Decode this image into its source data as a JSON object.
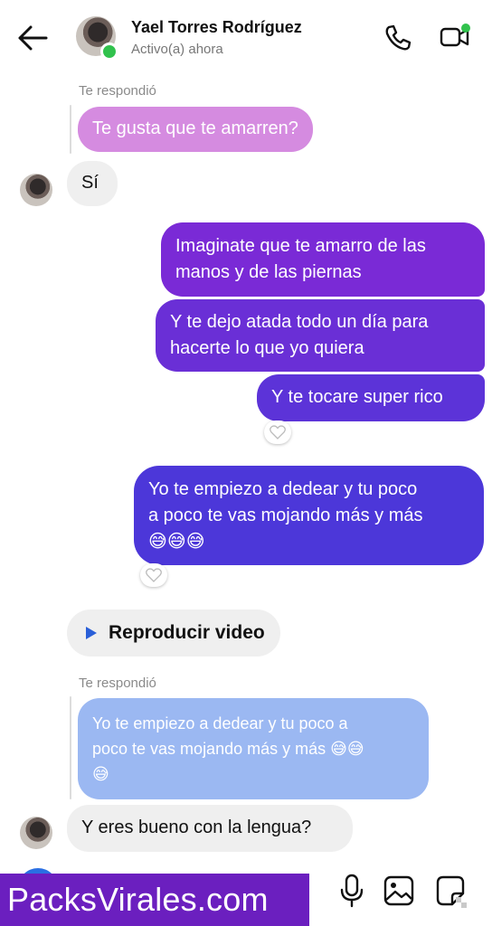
{
  "header": {
    "contact_name": "Yael Torres Rodríguez",
    "status": "Activo(a) ahora"
  },
  "thread": {
    "reply_label_1": "Te respondió",
    "quoted_1": "Te gusta que te amarren?",
    "incoming_1": "Sí",
    "outgoing_1": [
      "Imaginate que te amarro de las",
      "manos y de las piernas"
    ],
    "outgoing_2": [
      "Y te dejo atada todo un día para",
      "hacerte lo que yo quiera"
    ],
    "outgoing_3": "Y te tocare super rico",
    "outgoing_4": [
      "Yo te empiezo a dedear y tu poco",
      "a poco te vas mojando más y más",
      "😅😅😅"
    ],
    "video_label": "Reproducir video",
    "reply_label_2": "Te respondió",
    "quoted_2": [
      "Yo te empiezo a dedear y tu poco a",
      "poco te vas mojando más y más 😅😅",
      "😅"
    ],
    "incoming_2": "Y eres bueno con la lengua?"
  },
  "watermark": "PacksVirales.com",
  "colors": {
    "outgoing_top": "#7a2ad6",
    "outgoing_bottom": "#4c37d9",
    "quoted_pink": "#d58be0",
    "quoted_blue": "#9bb8f2",
    "online": "#31c24d",
    "watermark_bg": "#6b1fbf"
  },
  "icons": [
    "back-arrow-icon",
    "phone-icon",
    "video-call-icon",
    "heart-reaction-icon",
    "play-icon",
    "camera-icon",
    "microphone-icon",
    "gallery-icon",
    "sticker-icon"
  ]
}
